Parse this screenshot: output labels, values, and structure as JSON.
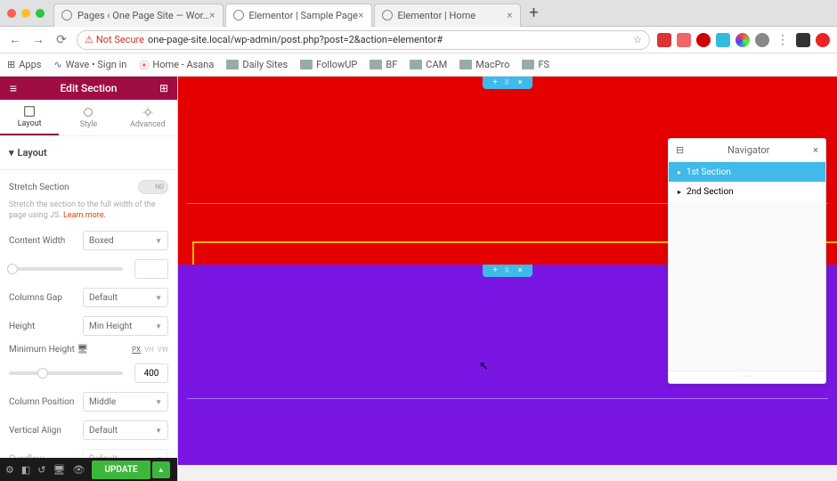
{
  "tabs": [
    {
      "title": "Pages ‹ One Page Site — Wor…"
    },
    {
      "title": "Elementor | Sample Page"
    },
    {
      "title": "Elementor | Home"
    }
  ],
  "addr": {
    "notSecure": "Not Secure",
    "url": "one-page-site.local/wp-admin/post.php?post=2&action=elementor#"
  },
  "bookmarks": [
    "Apps",
    "Wave • Sign in",
    "Home - Asana",
    "Daily Sites",
    "FollowUP",
    "BF",
    "CAM",
    "MacPro",
    "FS"
  ],
  "panel": {
    "title": "Edit Section",
    "subtabs": [
      "Layout",
      "Style",
      "Advanced"
    ],
    "sectionHead": "Layout",
    "stretch": {
      "label": "Stretch Section",
      "toggle": "NO",
      "help": "Stretch the section to the full width of the page using JS. ",
      "learn": "Learn more."
    },
    "contentWidth": {
      "label": "Content Width",
      "value": "Boxed"
    },
    "columnsGap": {
      "label": "Columns Gap",
      "value": "Default"
    },
    "heightRow": {
      "label": "Height",
      "value": "Min Height"
    },
    "minHeight": {
      "label": "Minimum Height",
      "units": [
        "PX",
        "VH",
        "VW"
      ],
      "value": "400"
    },
    "colPos": {
      "label": "Column Position",
      "value": "Middle"
    },
    "vAlign": {
      "label": "Vertical Align",
      "value": "Default"
    },
    "overflow": {
      "label": "Overflow",
      "value": "Default"
    },
    "update": "UPDATE"
  },
  "navigator": {
    "title": "Navigator",
    "items": [
      "1st Section",
      "2nd Section"
    ]
  }
}
